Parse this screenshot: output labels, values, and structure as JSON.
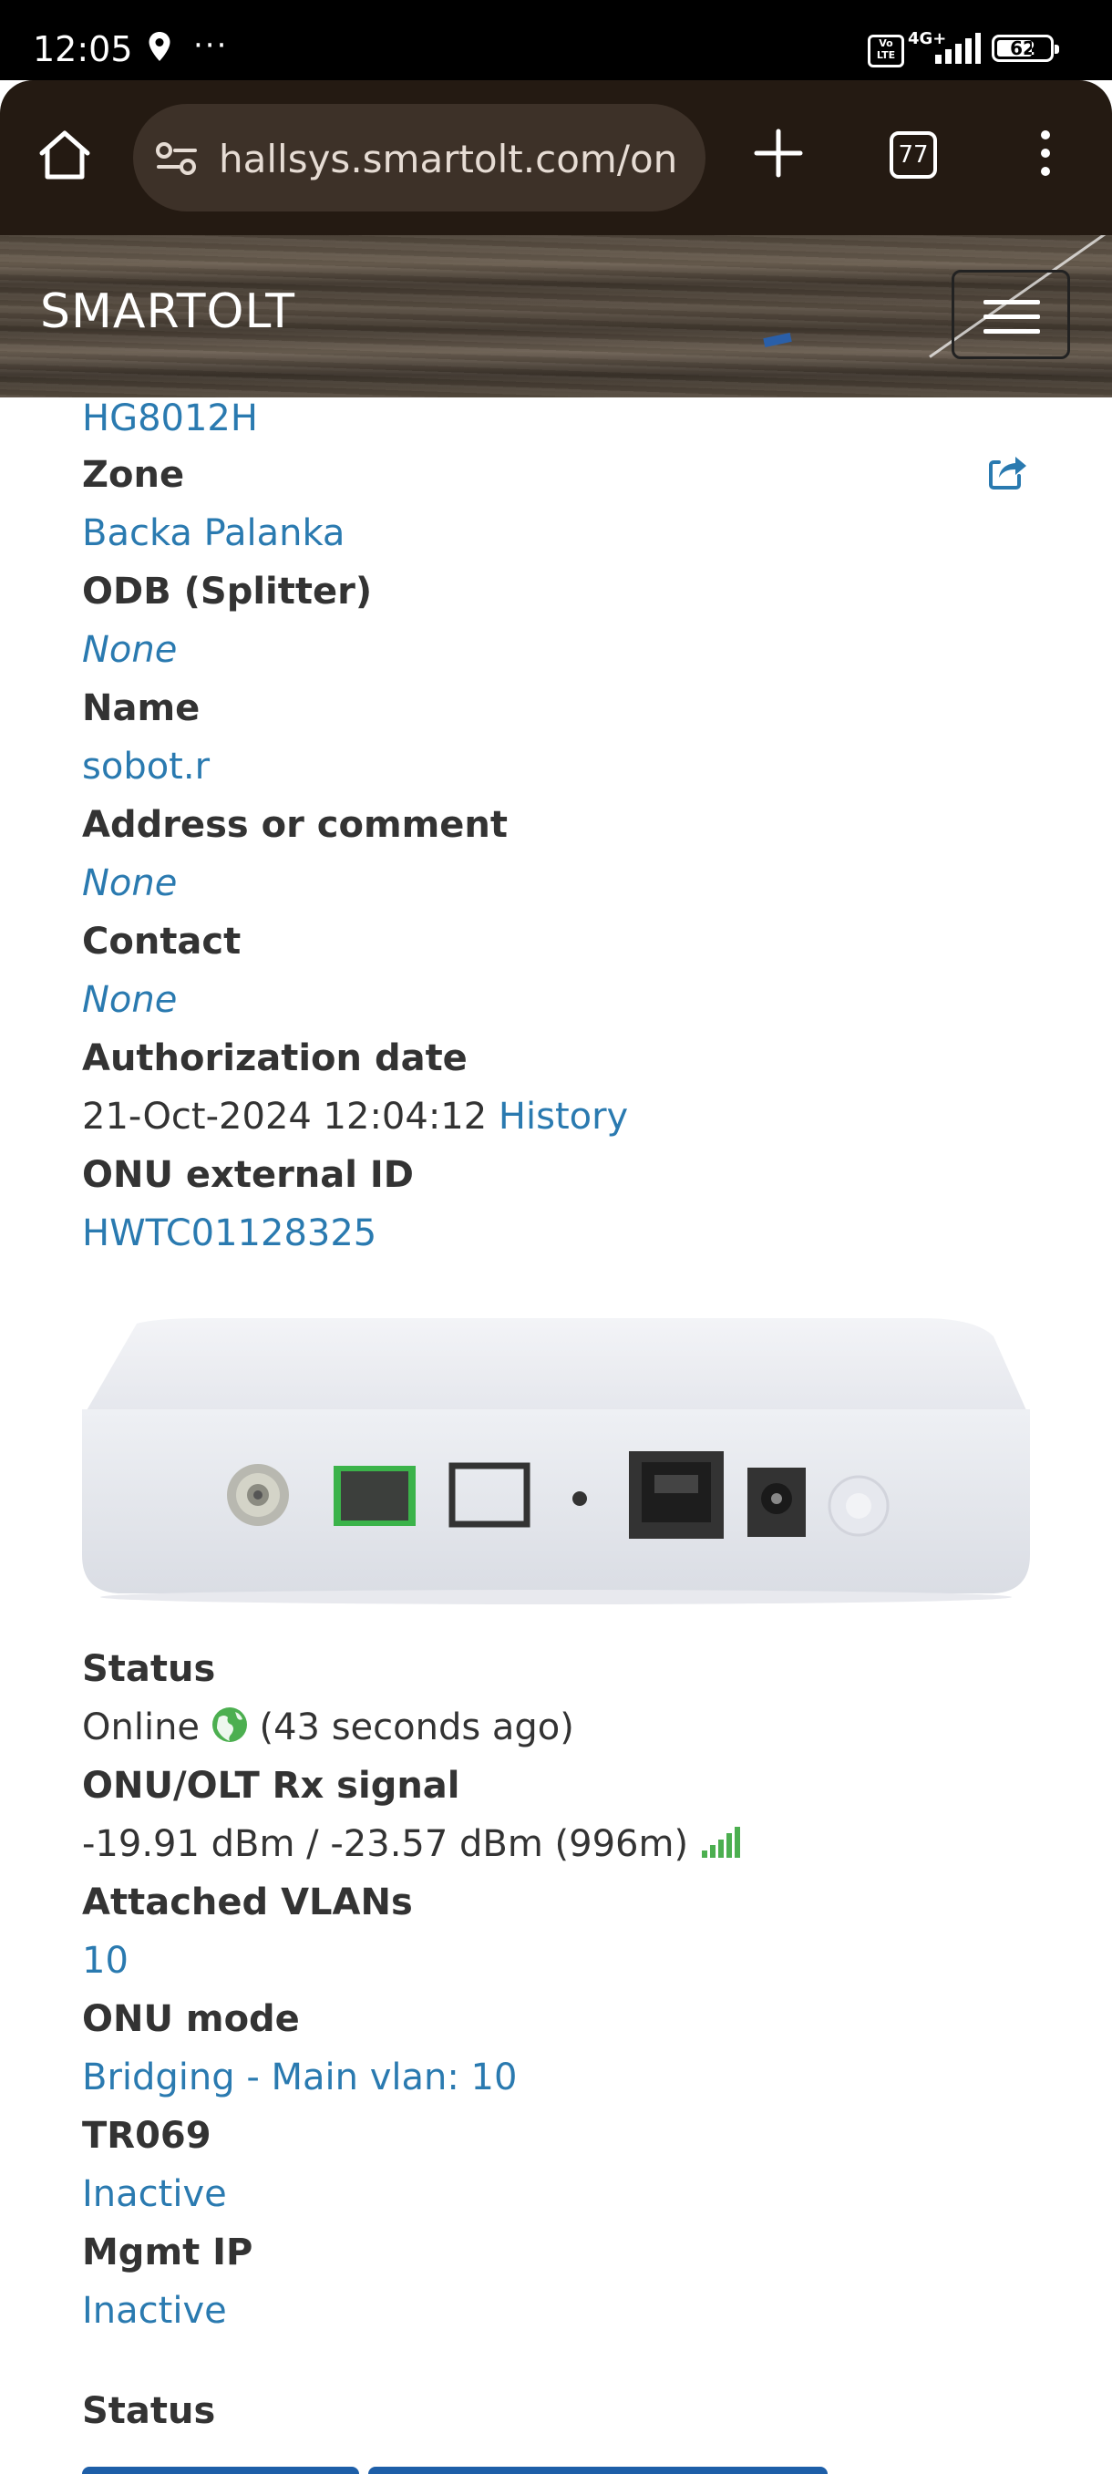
{
  "status_bar": {
    "time": "12:05",
    "dots": "···",
    "volte": "Vo LTE",
    "network": "4G+",
    "battery": "62"
  },
  "browser": {
    "url": "hallsys.smartolt.com/on",
    "tab_count": "77"
  },
  "navbar": {
    "brand": "SMARTOLT"
  },
  "details": {
    "onu_type_value": "HG8012H",
    "zone_label": "Zone",
    "zone_value": "Backa Palanka",
    "odb_label": "ODB (Splitter)",
    "odb_value": "None",
    "name_label": "Name",
    "name_value": "sobot.r",
    "address_label": "Address or comment",
    "address_value": "None",
    "contact_label": "Contact",
    "contact_value": "None",
    "auth_date_label": "Authorization date",
    "auth_date_value": "21-Oct-2024 12:04:12",
    "history_link": "History",
    "external_id_label": "ONU external ID",
    "external_id_value": "HWTC01128325",
    "status_label": "Status",
    "status_value": "Online",
    "status_ago": "(43 seconds ago)",
    "rx_label": "ONU/OLT Rx signal",
    "rx_value": "-19.91 dBm / -23.57 dBm (996m)",
    "vlans_label": "Attached VLANs",
    "vlans_value": "10",
    "mode_label": "ONU mode",
    "mode_value": "Bridging - Main vlan: 10",
    "tr069_label": "TR069",
    "tr069_value": "Inactive",
    "mgmt_ip_label": "Mgmt IP",
    "mgmt_ip_value": "Inactive",
    "status_section_label": "Status"
  },
  "colors": {
    "link": "#2a7ab0",
    "online_green": "#4caf50",
    "signal_green": "#4caf50",
    "tab_blue": "#1e5fa8"
  }
}
